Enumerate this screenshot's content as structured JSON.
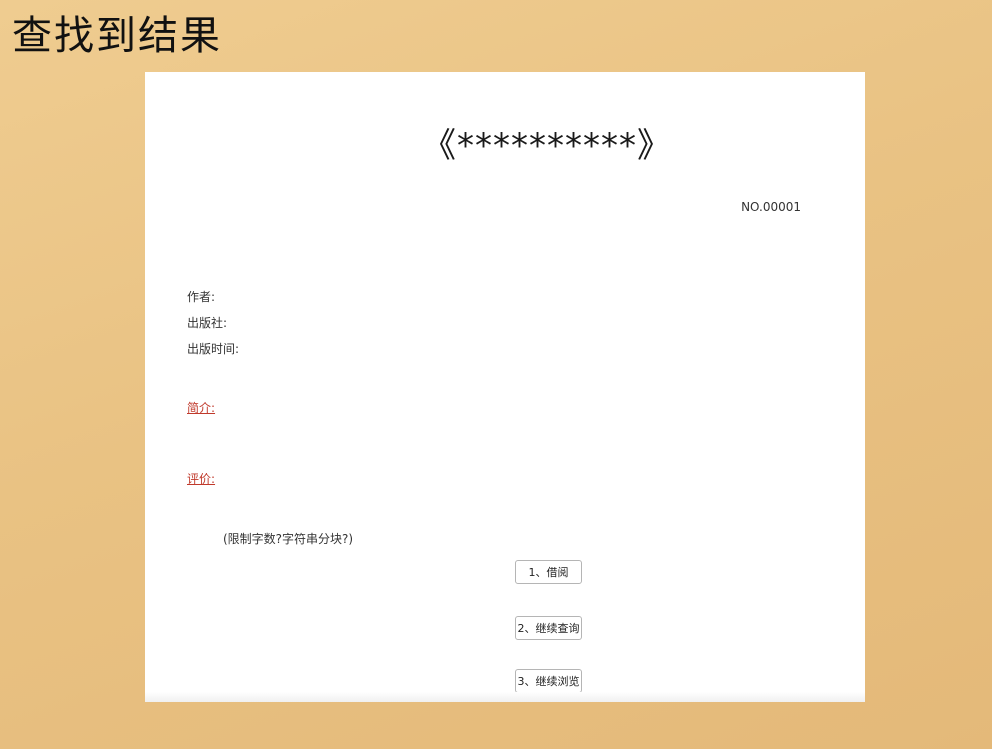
{
  "slide": {
    "title": "查找到结果"
  },
  "book": {
    "title": "《**********》",
    "serial_no": "NO.00001",
    "author_label": "作者:",
    "publisher_label": "出版社:",
    "publish_time_label": "出版时间:",
    "summary_link": "简介:",
    "review_link": "评价:",
    "note": "(限制字数?字符串分块?)"
  },
  "actions": {
    "borrow": "1、借阅",
    "continue_search": "2、继续查询",
    "continue_browse": "3、继续浏览"
  }
}
